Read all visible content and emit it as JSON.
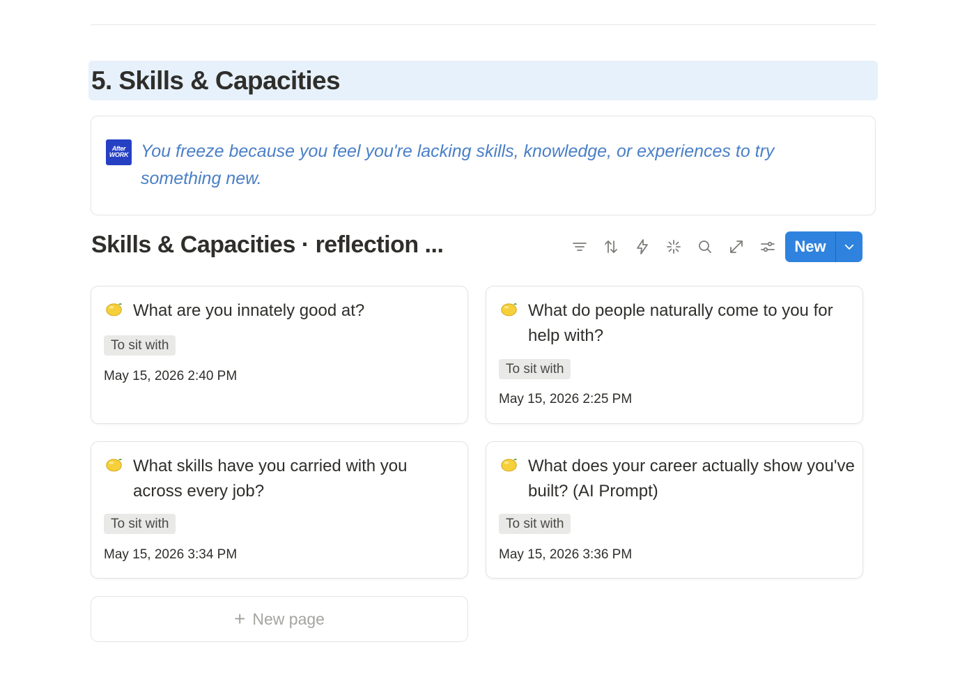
{
  "heading": {
    "text": "5. Skills & Capacities"
  },
  "callout": {
    "icon_text_1": "After",
    "icon_text_2": "WORK",
    "text": "You freeze because you feel you're lacking skills, knowledge, or experiences to try something new."
  },
  "database": {
    "title": "Skills & Capacities · reflection ...",
    "toolbar_icons": [
      "filter-icon",
      "sort-icon",
      "lightning-icon",
      "ai-sparkle-icon",
      "search-icon",
      "expand-icon",
      "settings-sliders-icon"
    ],
    "new_button_label": "New",
    "accent_color": "#2f83de"
  },
  "cards": [
    {
      "emoji": "lemon-icon",
      "title": "What are you innately good at?",
      "tag": "To sit with",
      "date": "May 15, 2026 2:40 PM"
    },
    {
      "emoji": "lemon-icon",
      "title": "What do people naturally come to you for help with?",
      "tag": "To sit with",
      "date": "May 15, 2026 2:25 PM"
    },
    {
      "emoji": "lemon-icon",
      "title": "What skills have you carried with you across every job?",
      "tag": "To sit with",
      "date": "May 15, 2026 3:34 PM"
    },
    {
      "emoji": "lemon-icon",
      "title": "What does your career actually show you've built? (AI Prompt)",
      "tag": "To sit with",
      "date": "May 15, 2026 3:36 PM"
    }
  ],
  "new_page": {
    "plus": "+",
    "label": "New page"
  }
}
